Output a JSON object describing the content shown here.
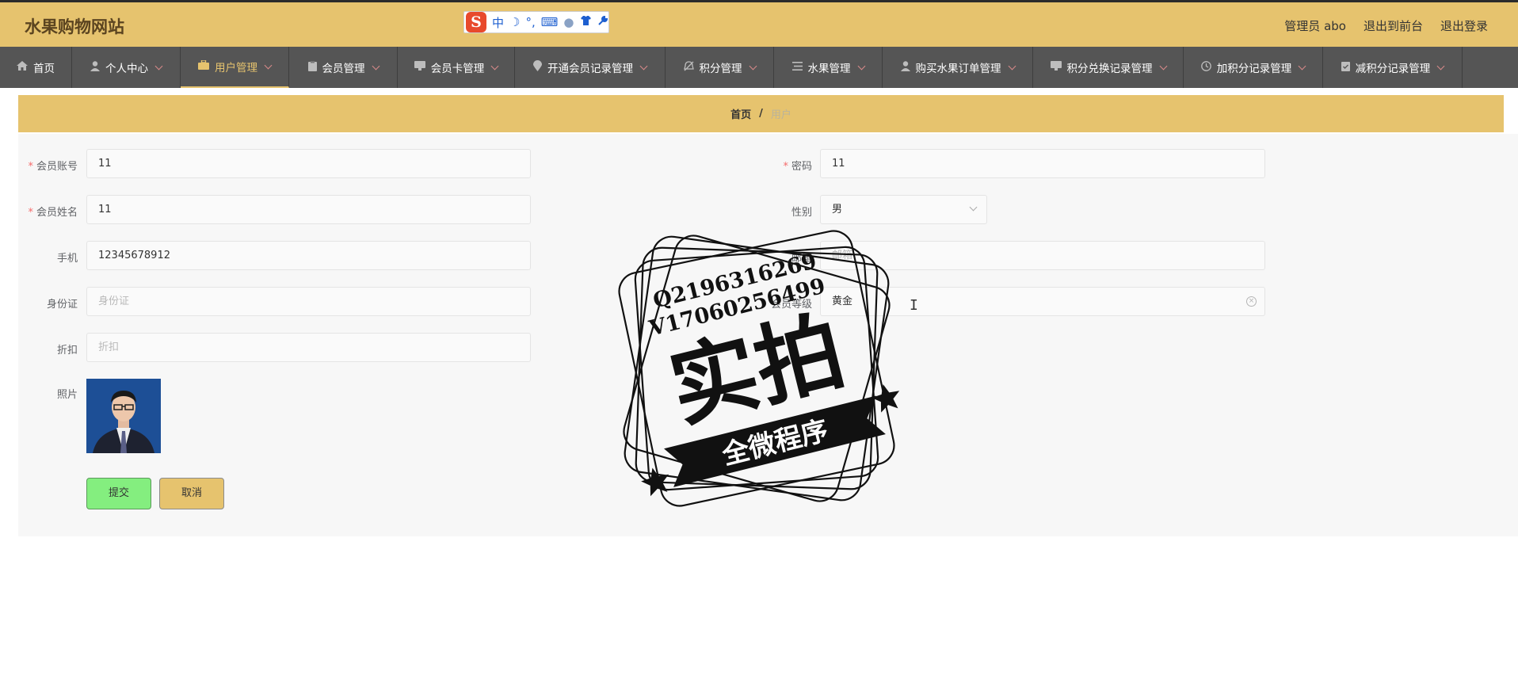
{
  "header": {
    "brand": "水果购物网站",
    "ime": {
      "logo": "S",
      "mode": "中",
      "moon": "☽",
      "punct": "°,",
      "keyboard": "⌨",
      "user": "●",
      "skin": "👕",
      "tools": "🔧"
    },
    "links": [
      "管理员 abo",
      "退出到前台",
      "退出登录"
    ]
  },
  "nav": {
    "items": [
      {
        "label": "首页",
        "icon": "home-icon",
        "active": false,
        "dropdown": false
      },
      {
        "label": "个人中心",
        "icon": "user-icon",
        "active": false,
        "dropdown": true
      },
      {
        "label": "用户管理",
        "icon": "briefcase-icon",
        "active": true,
        "dropdown": true
      },
      {
        "label": "会员管理",
        "icon": "clipboard-icon",
        "active": false,
        "dropdown": true
      },
      {
        "label": "会员卡管理",
        "icon": "monitor-icon",
        "active": false,
        "dropdown": true
      },
      {
        "label": "开通会员记录管理",
        "icon": "location-icon",
        "active": false,
        "dropdown": true
      },
      {
        "label": "积分管理",
        "icon": "bell-off-icon",
        "active": false,
        "dropdown": true
      },
      {
        "label": "水果管理",
        "icon": "list-icon",
        "active": false,
        "dropdown": true
      },
      {
        "label": "购买水果订单管理",
        "icon": "user-icon",
        "active": false,
        "dropdown": true
      },
      {
        "label": "积分兑换记录管理",
        "icon": "monitor-icon",
        "active": false,
        "dropdown": true
      },
      {
        "label": "加积分记录管理",
        "icon": "clock-icon",
        "active": false,
        "dropdown": true
      },
      {
        "label": "减积分记录管理",
        "icon": "clipboard-check-icon",
        "active": false,
        "dropdown": true
      }
    ]
  },
  "breadcrumb": {
    "home": "首页",
    "sep": "/",
    "current": "用户"
  },
  "form": {
    "account": {
      "label": "会员账号",
      "required": true,
      "value": "11"
    },
    "password": {
      "label": "密码",
      "required": true,
      "value": "11"
    },
    "name": {
      "label": "会员姓名",
      "required": true,
      "value": "11"
    },
    "gender": {
      "label": "性别",
      "value": "男"
    },
    "phone": {
      "label": "手机",
      "value": "12345678912"
    },
    "email": {
      "label": "邮箱",
      "placeholder": "邮箱"
    },
    "idcard": {
      "label": "身份证",
      "placeholder": "身份证"
    },
    "level": {
      "label": "会员等级",
      "value": "黄金"
    },
    "discount": {
      "label": "折扣",
      "placeholder": "折扣"
    },
    "photo": {
      "label": "照片"
    },
    "submit": "提交",
    "cancel": "取消"
  },
  "watermark": {
    "line1": "Q2196316269",
    "line2": "V17060256499",
    "big": "实拍",
    "ribbon": "全微程序"
  },
  "colors": {
    "accent": "#e6c36e",
    "nav_bg": "#555555",
    "submit": "#84ee7f"
  }
}
